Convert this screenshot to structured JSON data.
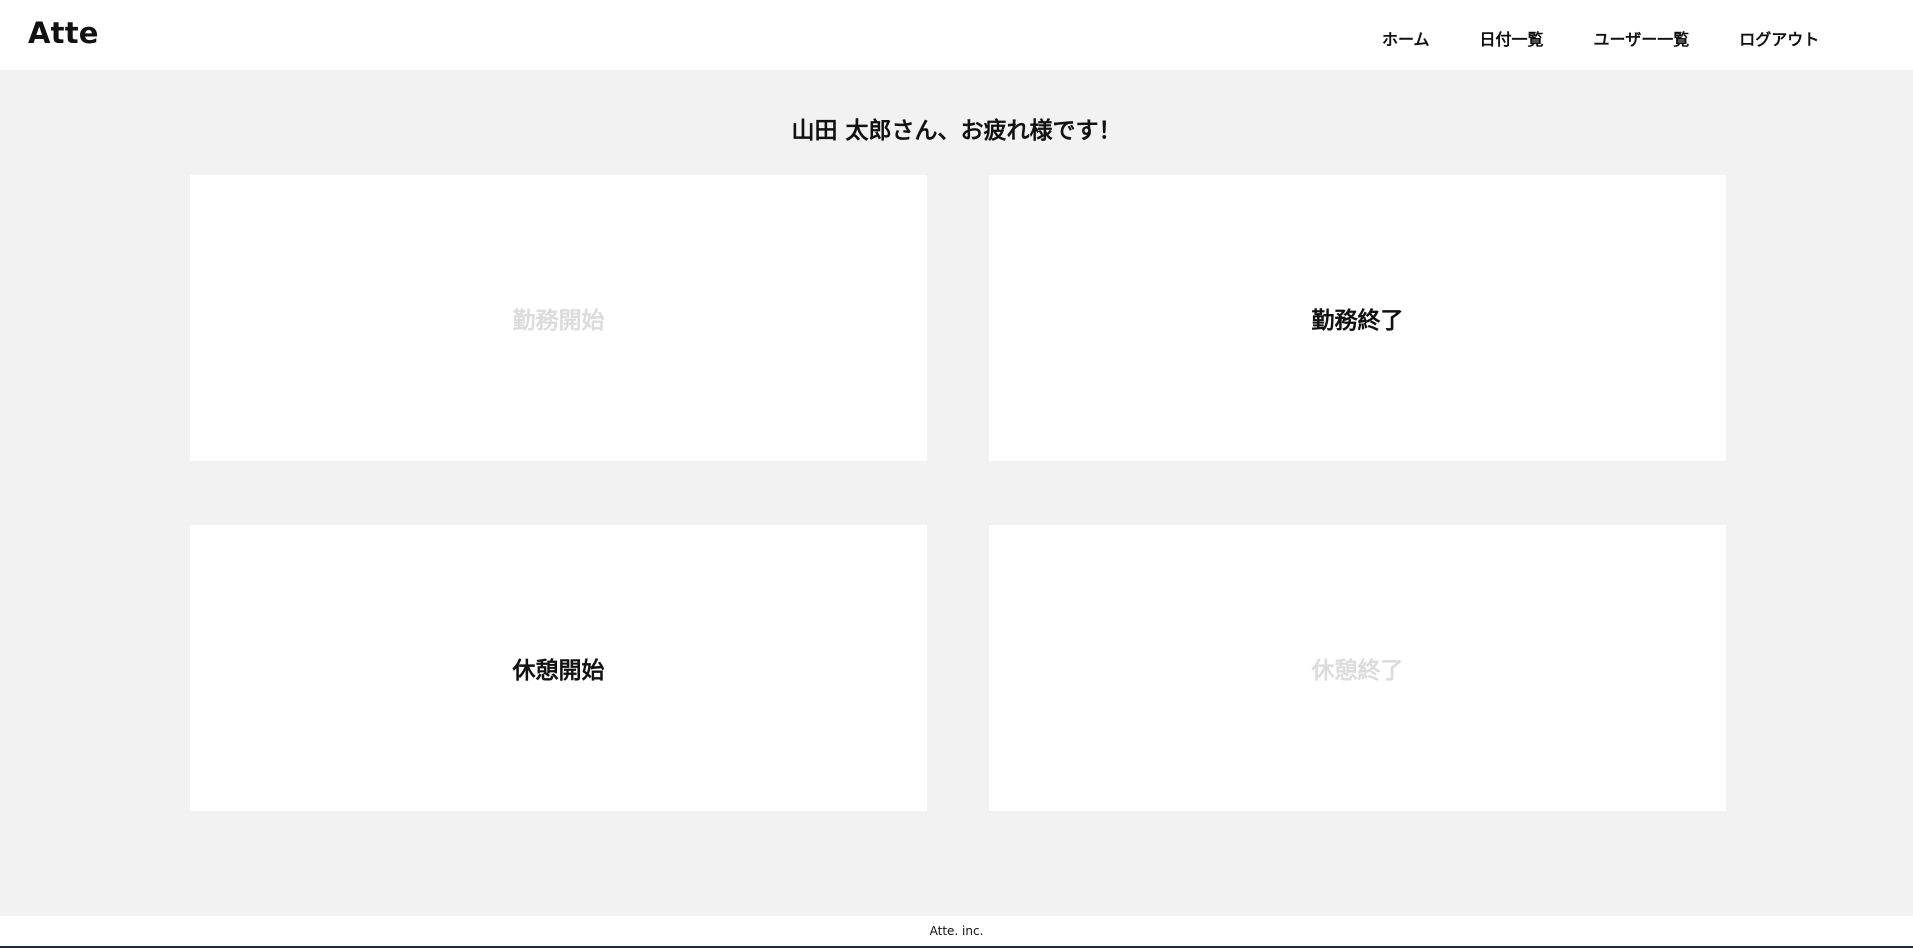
{
  "header": {
    "logo": "Atte",
    "nav": [
      {
        "label": "ホーム"
      },
      {
        "label": "日付一覧"
      },
      {
        "label": "ユーザー一覧"
      },
      {
        "label": "ログアウト"
      }
    ]
  },
  "main": {
    "greeting": "山田 太郎さん、お疲れ様です！",
    "buttons": [
      {
        "label": "勤務開始",
        "enabled": false
      },
      {
        "label": "勤務終了",
        "enabled": true
      },
      {
        "label": "休憩開始",
        "enabled": true
      },
      {
        "label": "休憩終了",
        "enabled": false
      }
    ]
  },
  "footer": {
    "text": "Atte. inc."
  },
  "colors": {
    "background": "#f2f2f2",
    "card": "#ffffff",
    "text": "#111111",
    "disabled_text": "#dcdcdc",
    "footer_border": "#1e2a3a"
  }
}
